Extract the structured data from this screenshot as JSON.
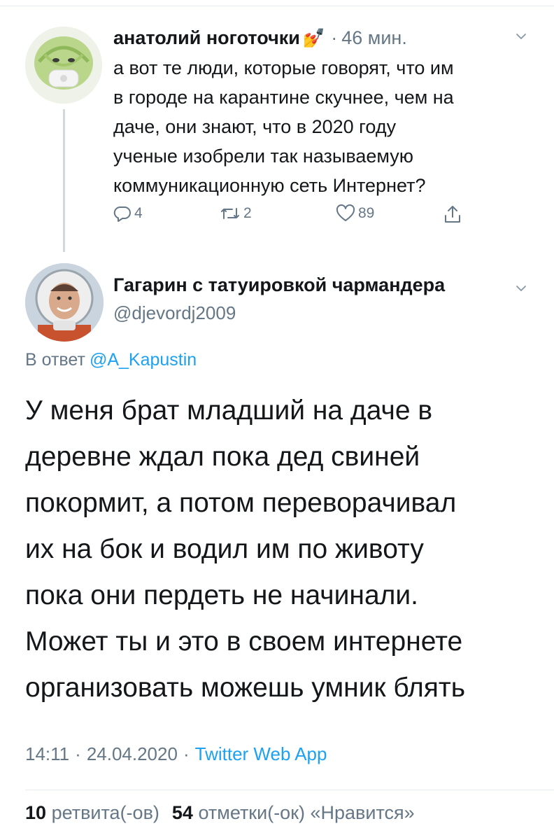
{
  "parent_tweet": {
    "author_name": "анатолий ноготочки",
    "name_emoji": "💅",
    "time_ago": "46 мин.",
    "text": "а вот те люди, которые говорят, что им\nв городе на карантине скучнее, чем на\nдаче, они знают, что в 2020 году\nученые изобрели так называемую\nкоммуникационную сеть Интернет?",
    "reply_count": "4",
    "retweet_count": "2",
    "like_count": "89",
    "icons": [
      "avatar",
      "chevron-down-icon",
      "reply-icon",
      "retweet-icon",
      "like-icon",
      "share-icon"
    ]
  },
  "main_tweet": {
    "author_name": "Гагарин с татуировкой чармандера",
    "handle": "@djevordj2009",
    "reply_prefix": "В ответ",
    "reply_mention": "@A_Kapustin",
    "text": "У меня брат младший на даче в\nдеревне ждал пока дед свиней\nпокормит, а потом переворачивал\nих на бок и водил им по животу\nпока они пердеть не начинали.\nМожет ты и это в своем интернете\nорганизовать можешь умник блять",
    "time": "14:11",
    "date": "24.04.2020",
    "separator": "·",
    "source": "Twitter Web App",
    "retweets_number": "10",
    "retweets_label": "ретвита(-ов)",
    "likes_number": "54",
    "likes_label": "отметки(-ок) «Нравится»"
  },
  "colors": {
    "text": "#14171a",
    "secondary": "#657786",
    "link": "#1da1f2",
    "divider": "#e6ecf0",
    "thread_line": "#cfd9de"
  }
}
